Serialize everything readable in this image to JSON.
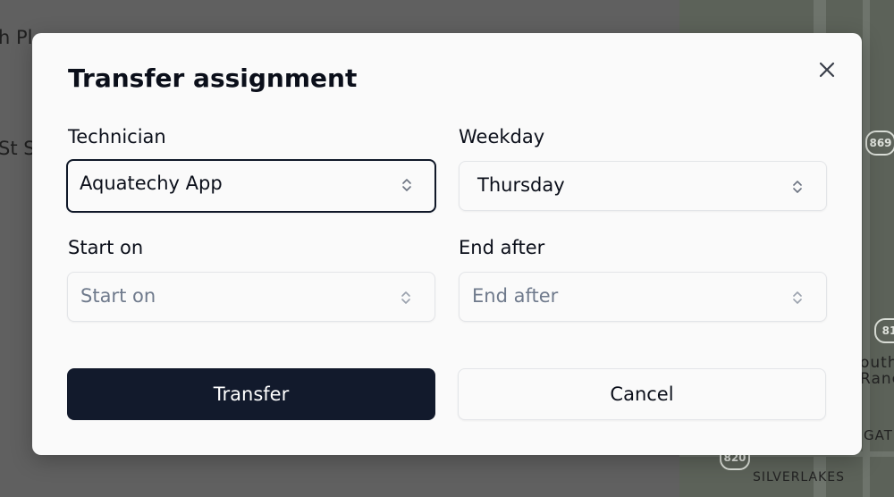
{
  "background": {
    "text_line_1": "h Pl",
    "text_line_2": "St S",
    "map": {
      "shield_1": "869",
      "shield_2": "81",
      "shield_3": "820",
      "label_1": "outh",
      "label_2": "Ranc",
      "label_3": "GAT",
      "label_4": "SILVERLAKES"
    }
  },
  "modal": {
    "title": "Transfer assignment",
    "close_icon": "close-icon",
    "technician": {
      "label": "Technician",
      "value": "Aquatechy App"
    },
    "weekday": {
      "label": "Weekday",
      "value": "Thursday"
    },
    "start_on": {
      "label": "Start on",
      "placeholder": "Start on"
    },
    "end_after": {
      "label": "End after",
      "placeholder": "End after"
    },
    "transfer_button": "Transfer",
    "cancel_button": "Cancel"
  },
  "colors": {
    "primary_button": "#121a2c",
    "overlay": "#606060",
    "modal_bg": "#fafafa",
    "placeholder_text": "#6f7a8c"
  }
}
